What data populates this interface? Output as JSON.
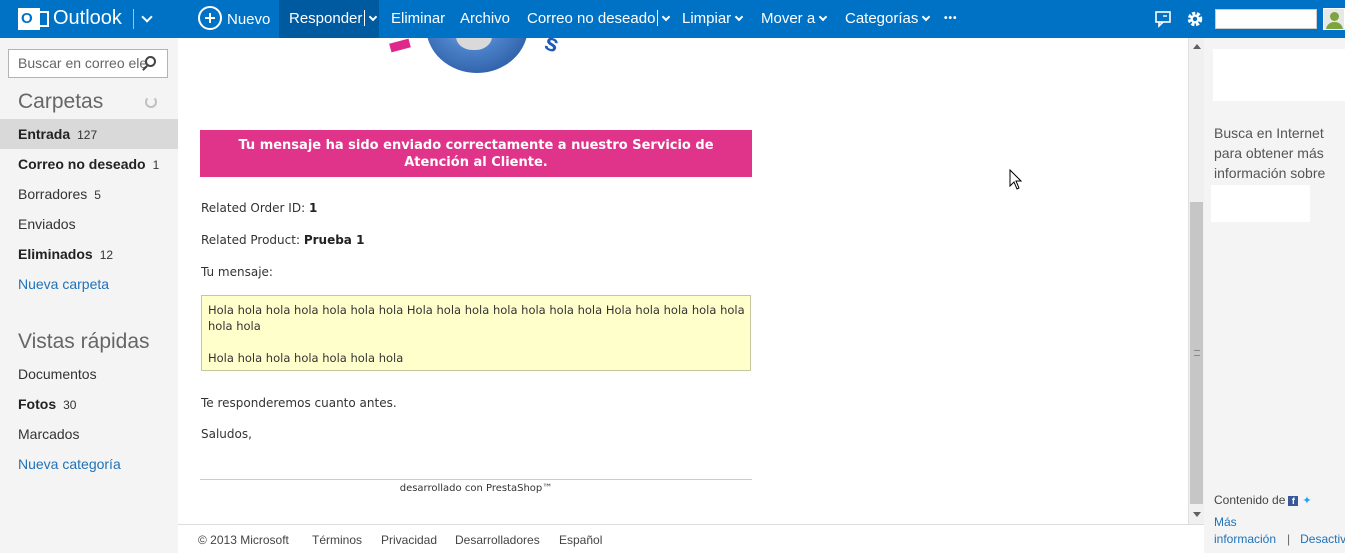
{
  "topbar": {
    "app_name": "Outlook",
    "new_label": "Nuevo",
    "reply_label": "Responder",
    "delete_label": "Eliminar",
    "archive_label": "Archivo",
    "junk_label": "Correo no deseado",
    "sweep_label": "Limpiar",
    "move_label": "Mover a",
    "categories_label": "Categorías",
    "more_label": "•••"
  },
  "leftnav": {
    "search_placeholder": "Buscar en correo ele",
    "folders_heading": "Carpetas",
    "folders": [
      {
        "label": "Entrada",
        "count": "127"
      },
      {
        "label": "Correo no deseado",
        "count": "1"
      },
      {
        "label": "Borradores",
        "count": "5"
      },
      {
        "label": "Enviados",
        "count": ""
      },
      {
        "label": "Eliminados",
        "count": "12"
      }
    ],
    "new_folder": "Nueva carpeta",
    "quick_views_heading": "Vistas rápidas",
    "quick_views": [
      {
        "label": "Documentos",
        "count": ""
      },
      {
        "label": "Fotos",
        "count": "30"
      },
      {
        "label": "Marcados",
        "count": ""
      }
    ],
    "new_category": "Nueva categoría"
  },
  "email": {
    "banner": "Tu mensaje ha sido enviado correctamente a nuestro Servicio de Atención al Cliente.",
    "order_id_label": "Related Order ID: ",
    "order_id_value": "1",
    "product_label": "Related Product: ",
    "product_value": "Prueba 1",
    "message_label": "Tu mensaje:",
    "message_line1": "Hola hola hola hola hola hola hola Hola hola hola hola hola hola hola Hola hola hola hola hola hola hola",
    "message_line2": "Hola hola hola hola hola hola hola",
    "closing_1": "Te responderemos cuanto antes.",
    "closing_2": "Saludos,",
    "powered_by": "desarrollado con PrestaShop™"
  },
  "rightpane": {
    "search_prompt": "Busca en Internet para obtener más información sobre",
    "content_by": "Contenido de",
    "more_info": "Más información",
    "deactivate": "Desactivar"
  },
  "footer": {
    "copyright": "© 2013 Microsoft",
    "terms": "Términos",
    "privacy": "Privacidad",
    "developers": "Desarrolladores",
    "language": "Español"
  },
  "colors": {
    "topbar": "#0072c6",
    "banner": "#e0348a",
    "message_box": "#ffffcc",
    "link": "#2072b8"
  }
}
